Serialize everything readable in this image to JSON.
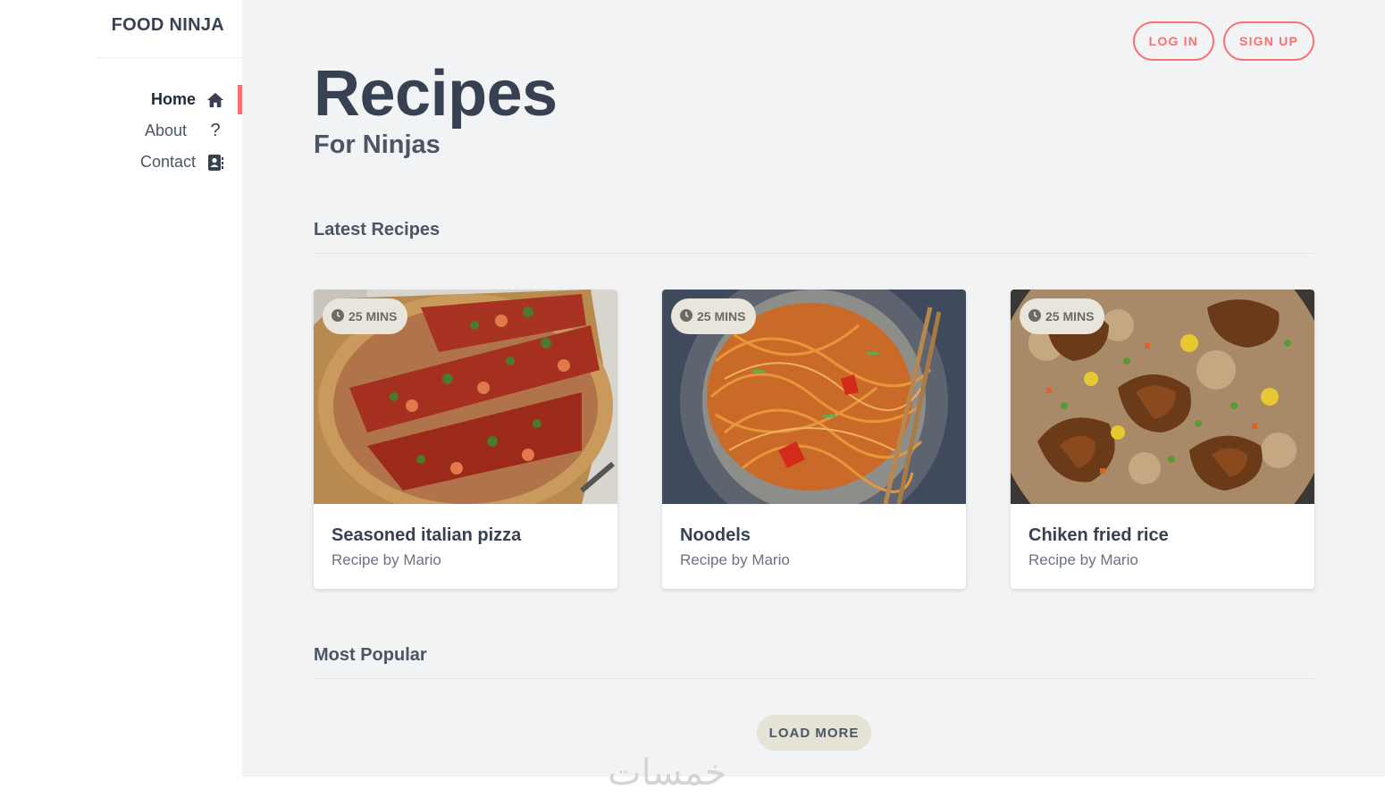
{
  "sidebar": {
    "logo": "FOOD NINJA",
    "items": [
      {
        "label": "Home",
        "icon": "home-icon",
        "active": true
      },
      {
        "label": "About",
        "icon": "question-icon",
        "active": false
      },
      {
        "label": "Contact",
        "icon": "address-book-icon",
        "active": false
      }
    ]
  },
  "header": {
    "login_label": "LOG IN",
    "signup_label": "SIGN UP",
    "title": "Recipes",
    "subtitle": "For Ninjas"
  },
  "sections": {
    "latest": "Latest Recipes",
    "popular": "Most Popular"
  },
  "cards": [
    {
      "badge": "25 MINS",
      "title": "Seasoned italian pizza",
      "author": "Recipe by Mario",
      "image": "pizza"
    },
    {
      "badge": "25 MINS",
      "title": "Noodels",
      "author": "Recipe by Mario",
      "image": "noodles"
    },
    {
      "badge": "25 MINS",
      "title": "Chiken fried rice",
      "author": "Recipe by Mario",
      "image": "fried-rice"
    }
  ],
  "load_more_label": "LOAD MORE",
  "watermark": "خمسات",
  "colors": {
    "accent": "#f87171",
    "text_dark": "#374151",
    "main_bg": "#f2f3f5",
    "badge_bg": "#e8e6dc"
  }
}
